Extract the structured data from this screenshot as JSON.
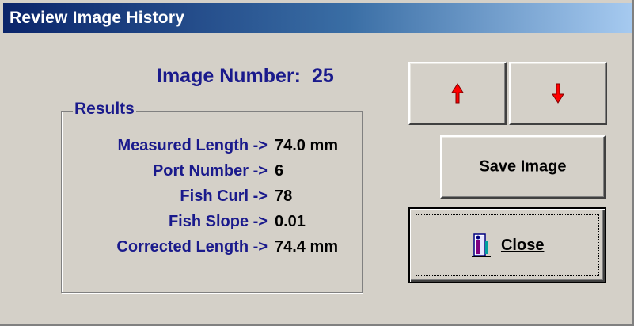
{
  "window": {
    "title": "Review Image History"
  },
  "image_number": {
    "label": "Image Number:",
    "value": "25"
  },
  "results": {
    "legend": "Results",
    "rows": [
      {
        "label": "Measured Length ->",
        "value": "74.0 mm"
      },
      {
        "label": "Port Number ->",
        "value": "6"
      },
      {
        "label": "Fish Curl ->",
        "value": "78"
      },
      {
        "label": "Fish Slope ->",
        "value": "0.01"
      },
      {
        "label": "Corrected Length ->",
        "value": "74.4 mm"
      }
    ]
  },
  "buttons": {
    "up_icon": "red-up-arrow-icon",
    "down_icon": "red-down-arrow-icon",
    "save_image": "Save Image",
    "close": "Close",
    "close_icon": "door-exit-icon"
  },
  "colors": {
    "title_bar_start": "#0a246a",
    "title_bar_end": "#a6caf0",
    "label_text": "#1a1a8c",
    "arrow": "#ff0000",
    "window_bg": "#d4d0c8"
  }
}
